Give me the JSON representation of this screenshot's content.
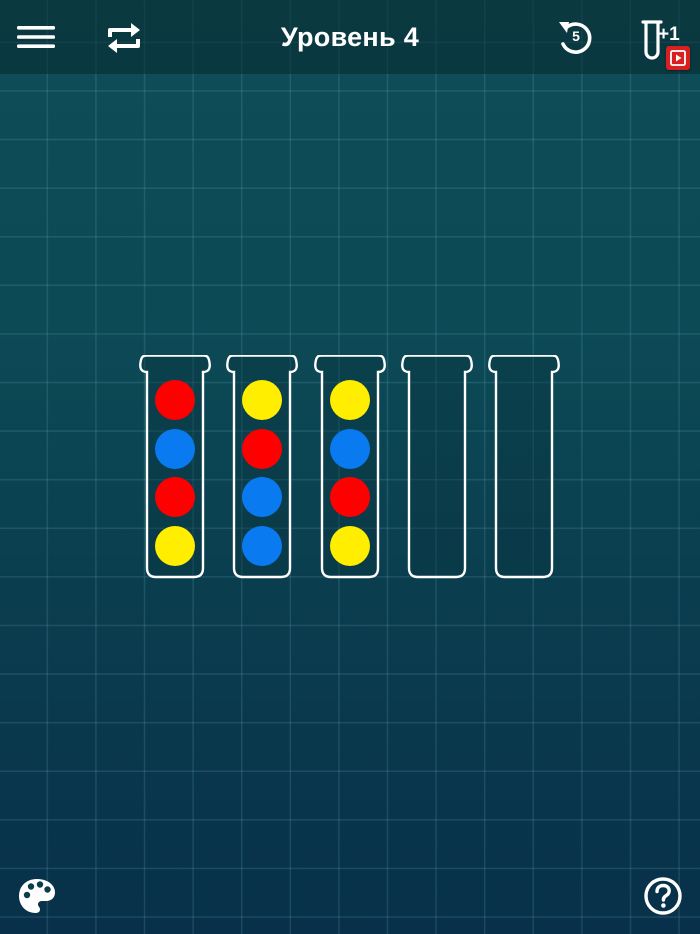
{
  "header": {
    "title": "Уровень 4",
    "undo_count": "5",
    "add_tube_label": "+1"
  },
  "icons": {
    "menu": "hamburger-menu-icon",
    "restart": "restart-repeat-icon",
    "undo": "undo-icon",
    "add_tube": "add-tube-icon",
    "video": "video-ad-icon",
    "palette": "palette-icon",
    "help": "help-icon"
  },
  "colors": {
    "background": "#0c4a56",
    "red": "#ff0000",
    "blue": "#0a7af0",
    "yellow": "#ffee00",
    "tube_outline": "#ffffff",
    "badge": "#d92020"
  },
  "tubes": [
    {
      "balls_top_to_bottom": [
        "red",
        "blue",
        "red",
        "yellow"
      ]
    },
    {
      "balls_top_to_bottom": [
        "yellow",
        "red",
        "blue",
        "blue"
      ]
    },
    {
      "balls_top_to_bottom": [
        "yellow",
        "blue",
        "red",
        "yellow"
      ]
    },
    {
      "balls_top_to_bottom": []
    },
    {
      "balls_top_to_bottom": []
    }
  ]
}
